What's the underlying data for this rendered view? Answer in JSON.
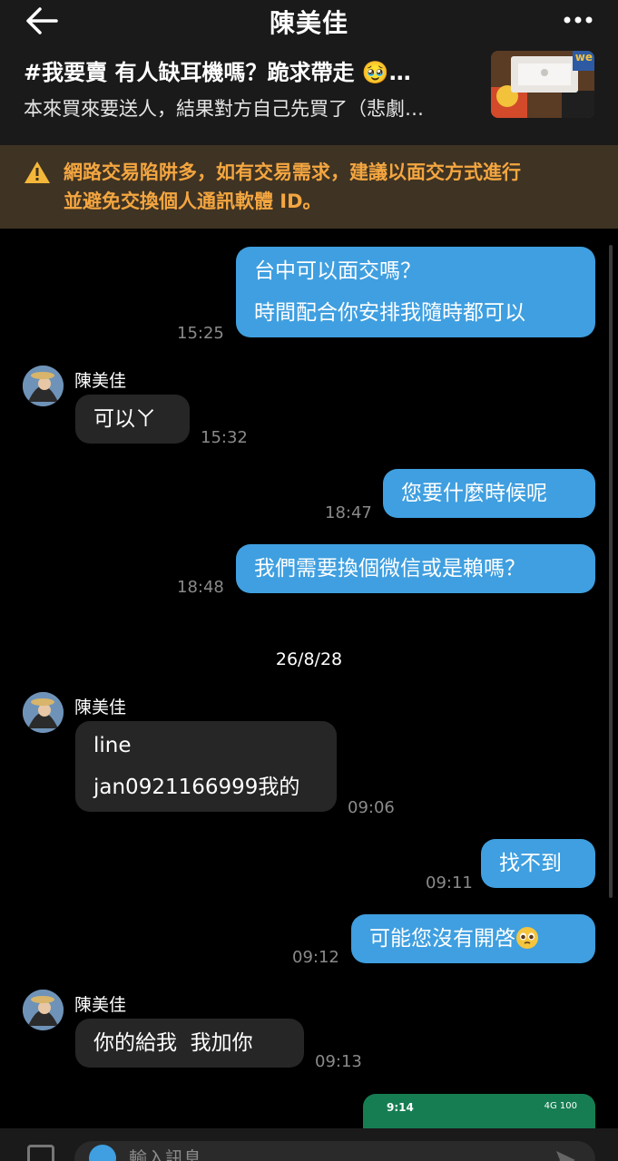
{
  "header": {
    "contact_name": "陳美佳",
    "listing_title": "#我要賣 有人缺耳機嗎？跪求帶走 🥹…",
    "listing_subtitle": "本來買來要送人，結果對方自己先買了（悲劇…",
    "thumbnail_text": "we"
  },
  "warning": {
    "line1": "網路交易陷阱多，如有交易需求，建議以面交方式進行",
    "line2": "並避免交換個人通訊軟體 ID。"
  },
  "messages": [
    {
      "dir": "out",
      "lines": [
        "台中可以面交嗎？",
        "時間配合你安排我隨時都可以"
      ],
      "time": "15:25"
    },
    {
      "dir": "in",
      "sender": "陳美佳",
      "lines": [
        "可以ㄚ"
      ],
      "time": "15:32"
    },
    {
      "dir": "out",
      "lines": [
        "您要什麼時候呢"
      ],
      "time": "18:47"
    },
    {
      "dir": "out",
      "lines": [
        "我們需要換個微信或是賴嗎？"
      ],
      "time": "18:48"
    },
    {
      "dir": "in",
      "sender": "陳美佳",
      "lines": [
        "line",
        "jan0921166999我的"
      ],
      "time": "09:06"
    },
    {
      "dir": "out",
      "lines": [
        "找不到"
      ],
      "time": "09:11"
    },
    {
      "dir": "out",
      "lines": [
        "可能您沒有開啓"
      ],
      "time": "09:12"
    },
    {
      "dir": "in",
      "sender": "陳美佳",
      "lines": [
        "你的給我  我加你"
      ],
      "time": "09:13"
    }
  ],
  "date_separator": "26/8/28",
  "screenshot_preview": {
    "time": "9:14",
    "status": "4G 100"
  },
  "composer": {
    "placeholder": "輸入訊息"
  },
  "colors": {
    "outgoing": "#3f9fe0",
    "incoming": "#262626",
    "warning_text": "#f4a640",
    "warning_bg": "#3f3323"
  }
}
